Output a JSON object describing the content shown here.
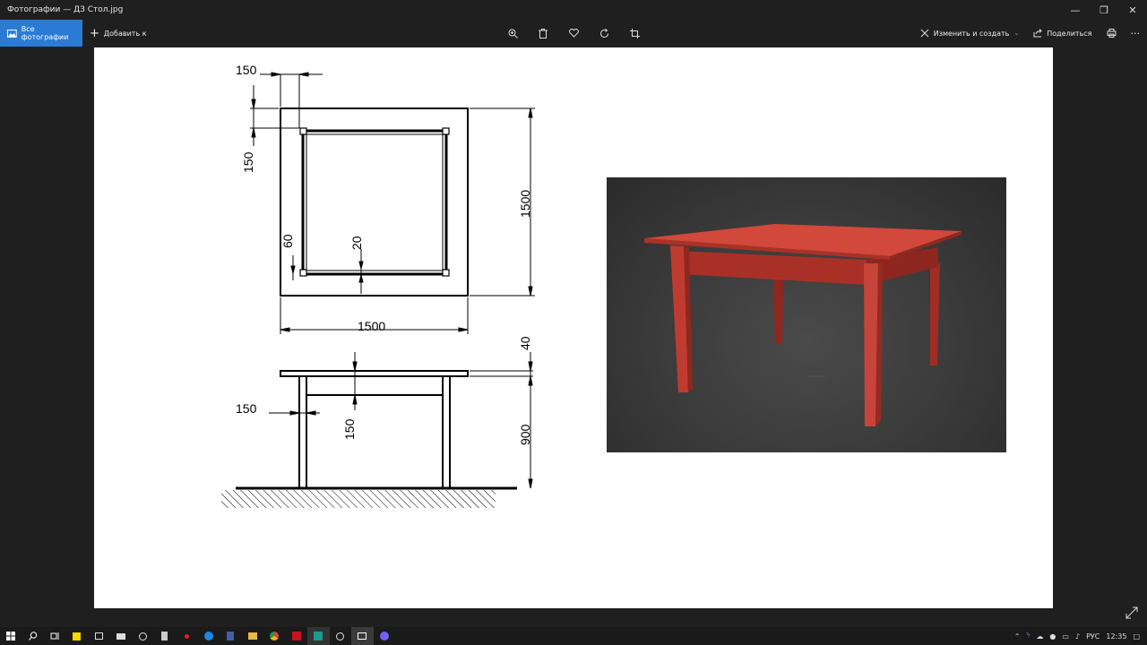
{
  "window": {
    "title": "Фотографии — ДЗ Стол.jpg",
    "minimize_icon": "minimize-icon",
    "maximize_icon": "restore-icon",
    "close_icon": "close-icon"
  },
  "toolbar": {
    "all_photos_label": "Все фотографии",
    "add_label": "Добавить к",
    "edit_create_label": "Изменить и создать",
    "share_label": "Поделиться",
    "center_icons": [
      "zoom-icon",
      "delete-icon",
      "favorite-icon",
      "rotate-icon",
      "crop-icon"
    ],
    "more_label": "···"
  },
  "drawing": {
    "dims": {
      "top_left_h": "150",
      "top_left_v": "150",
      "inner_60": "60",
      "inner_20": "20",
      "side_right": "1500",
      "bottom_width": "1500",
      "front_40": "40",
      "front_150_left": "150",
      "front_150_mid": "150",
      "front_900": "900"
    },
    "render_color": "#c0392b"
  },
  "taskbar": {
    "language": "РУС",
    "time": "12:35"
  },
  "colors": {
    "accent": "#2b7bd4",
    "background": "#1f1f1f"
  }
}
